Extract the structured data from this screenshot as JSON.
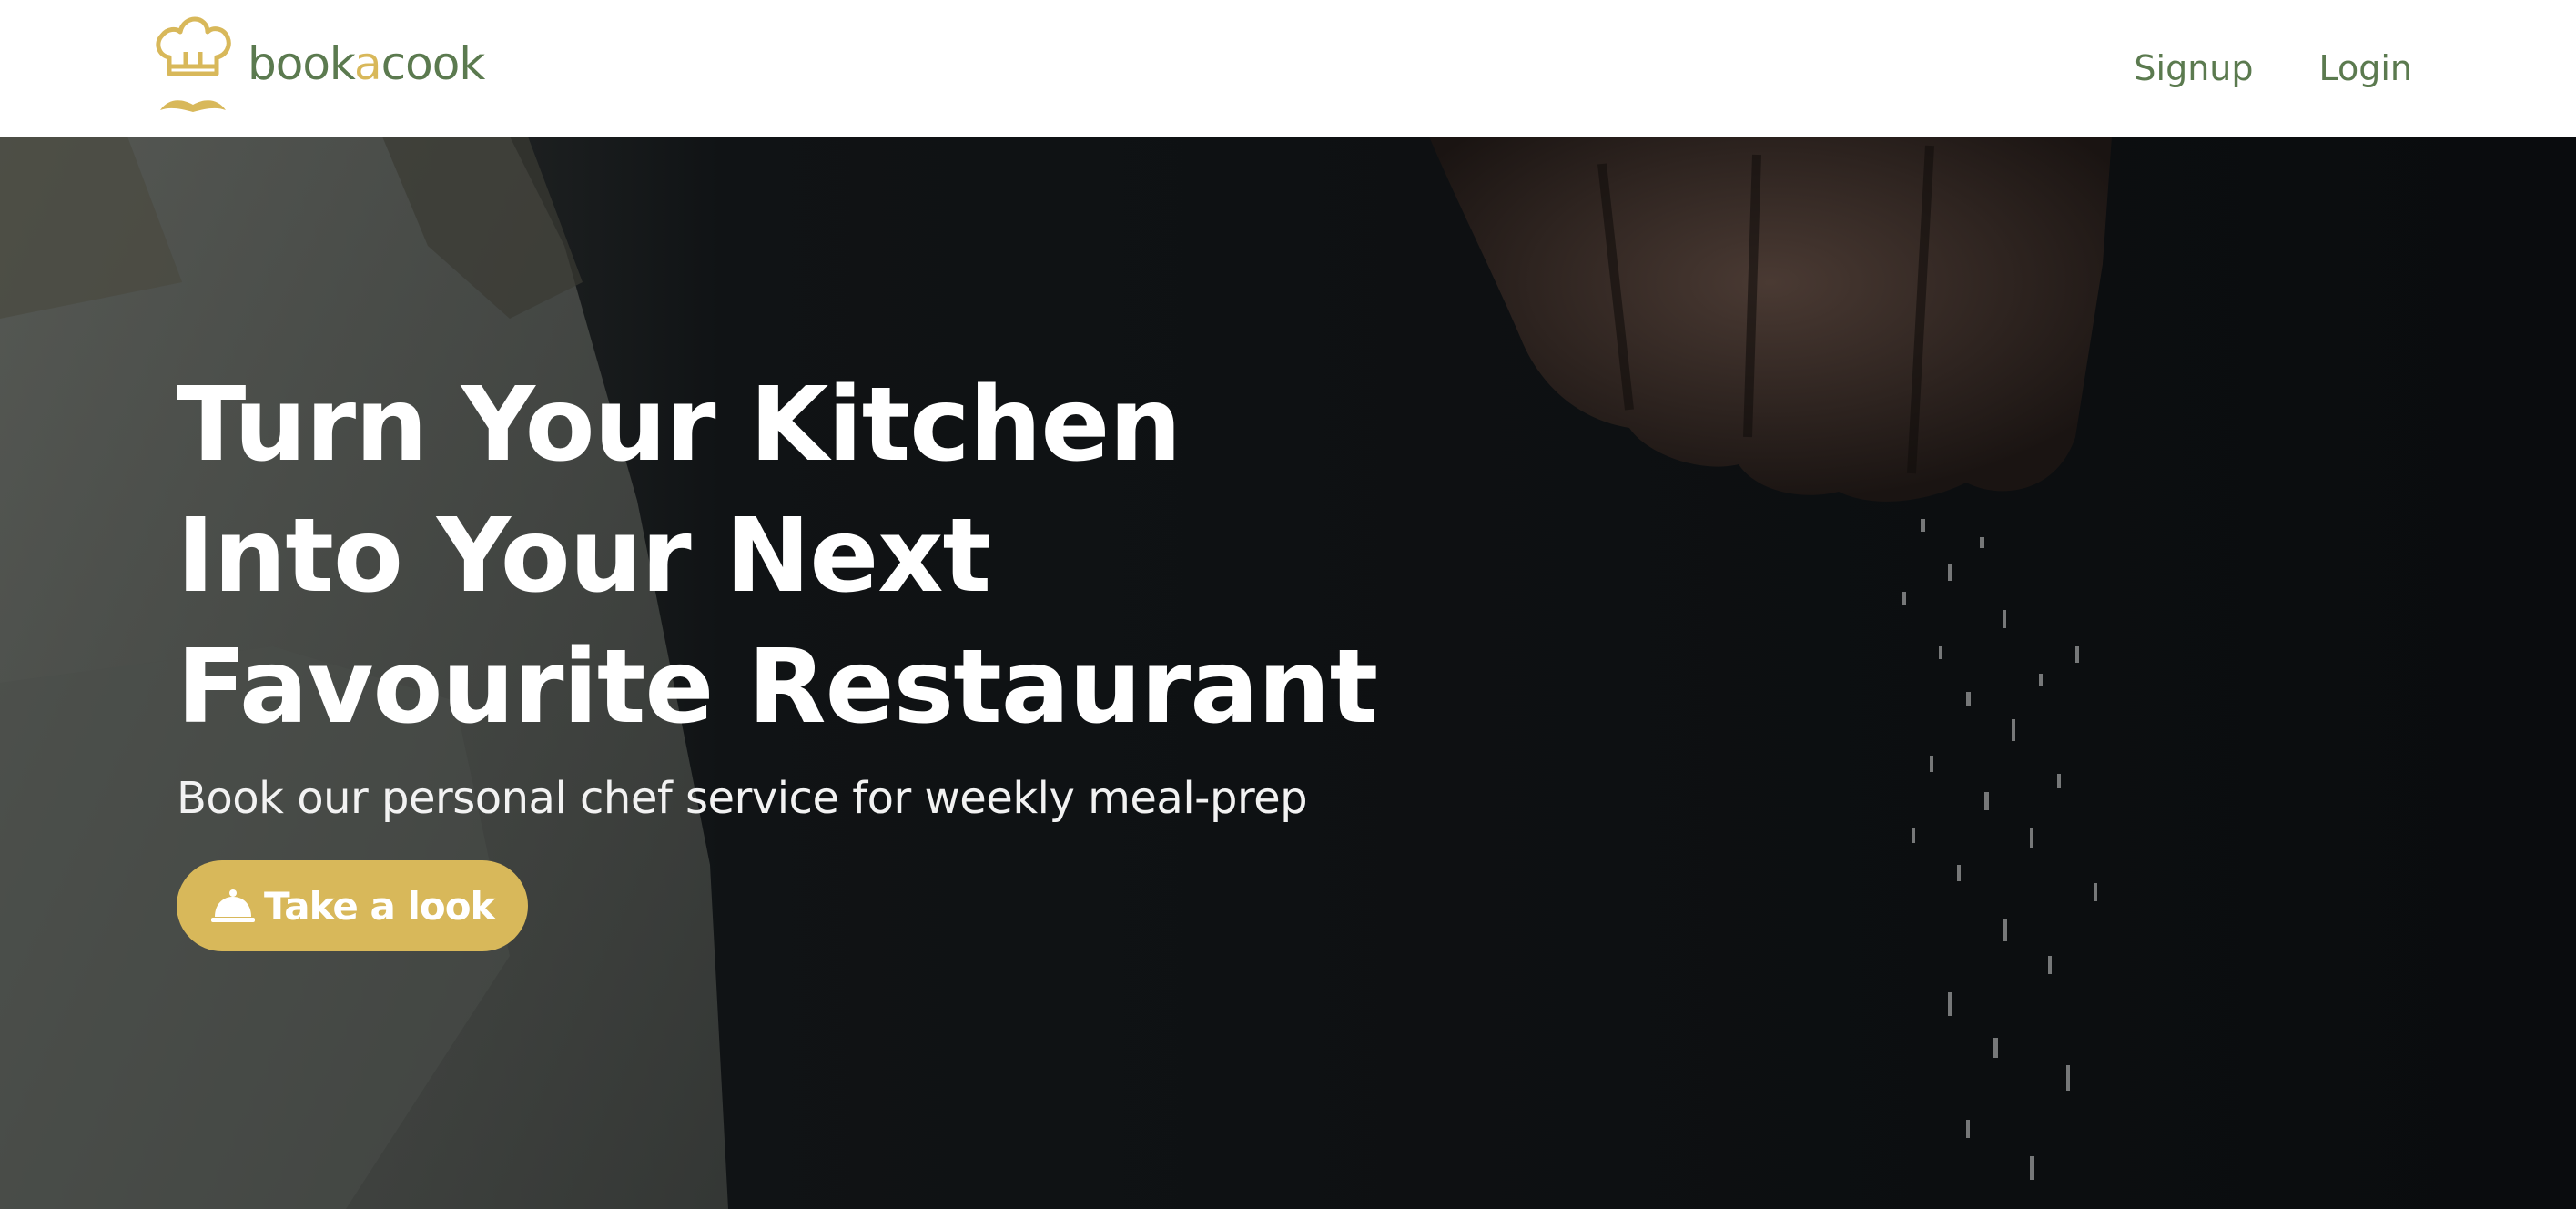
{
  "brand": {
    "name_part1": "book",
    "name_accent": "a",
    "name_part2": "cook",
    "logo_icon": "chef-hat-mustache-icon",
    "colors": {
      "green": "#5b7a4f",
      "gold": "#d8b85a"
    }
  },
  "nav": {
    "signup_label": "Signup",
    "login_label": "Login"
  },
  "hero": {
    "title_lines": [
      "Turn Your Kitchen",
      "Into Your Next",
      "Favourite Restaurant"
    ],
    "subtitle": "Book our personal chef service for weekly meal-prep",
    "cta": {
      "label": "Take a look",
      "icon": "cloche-icon"
    },
    "background": "chef-sprinkling-salt-photo"
  }
}
